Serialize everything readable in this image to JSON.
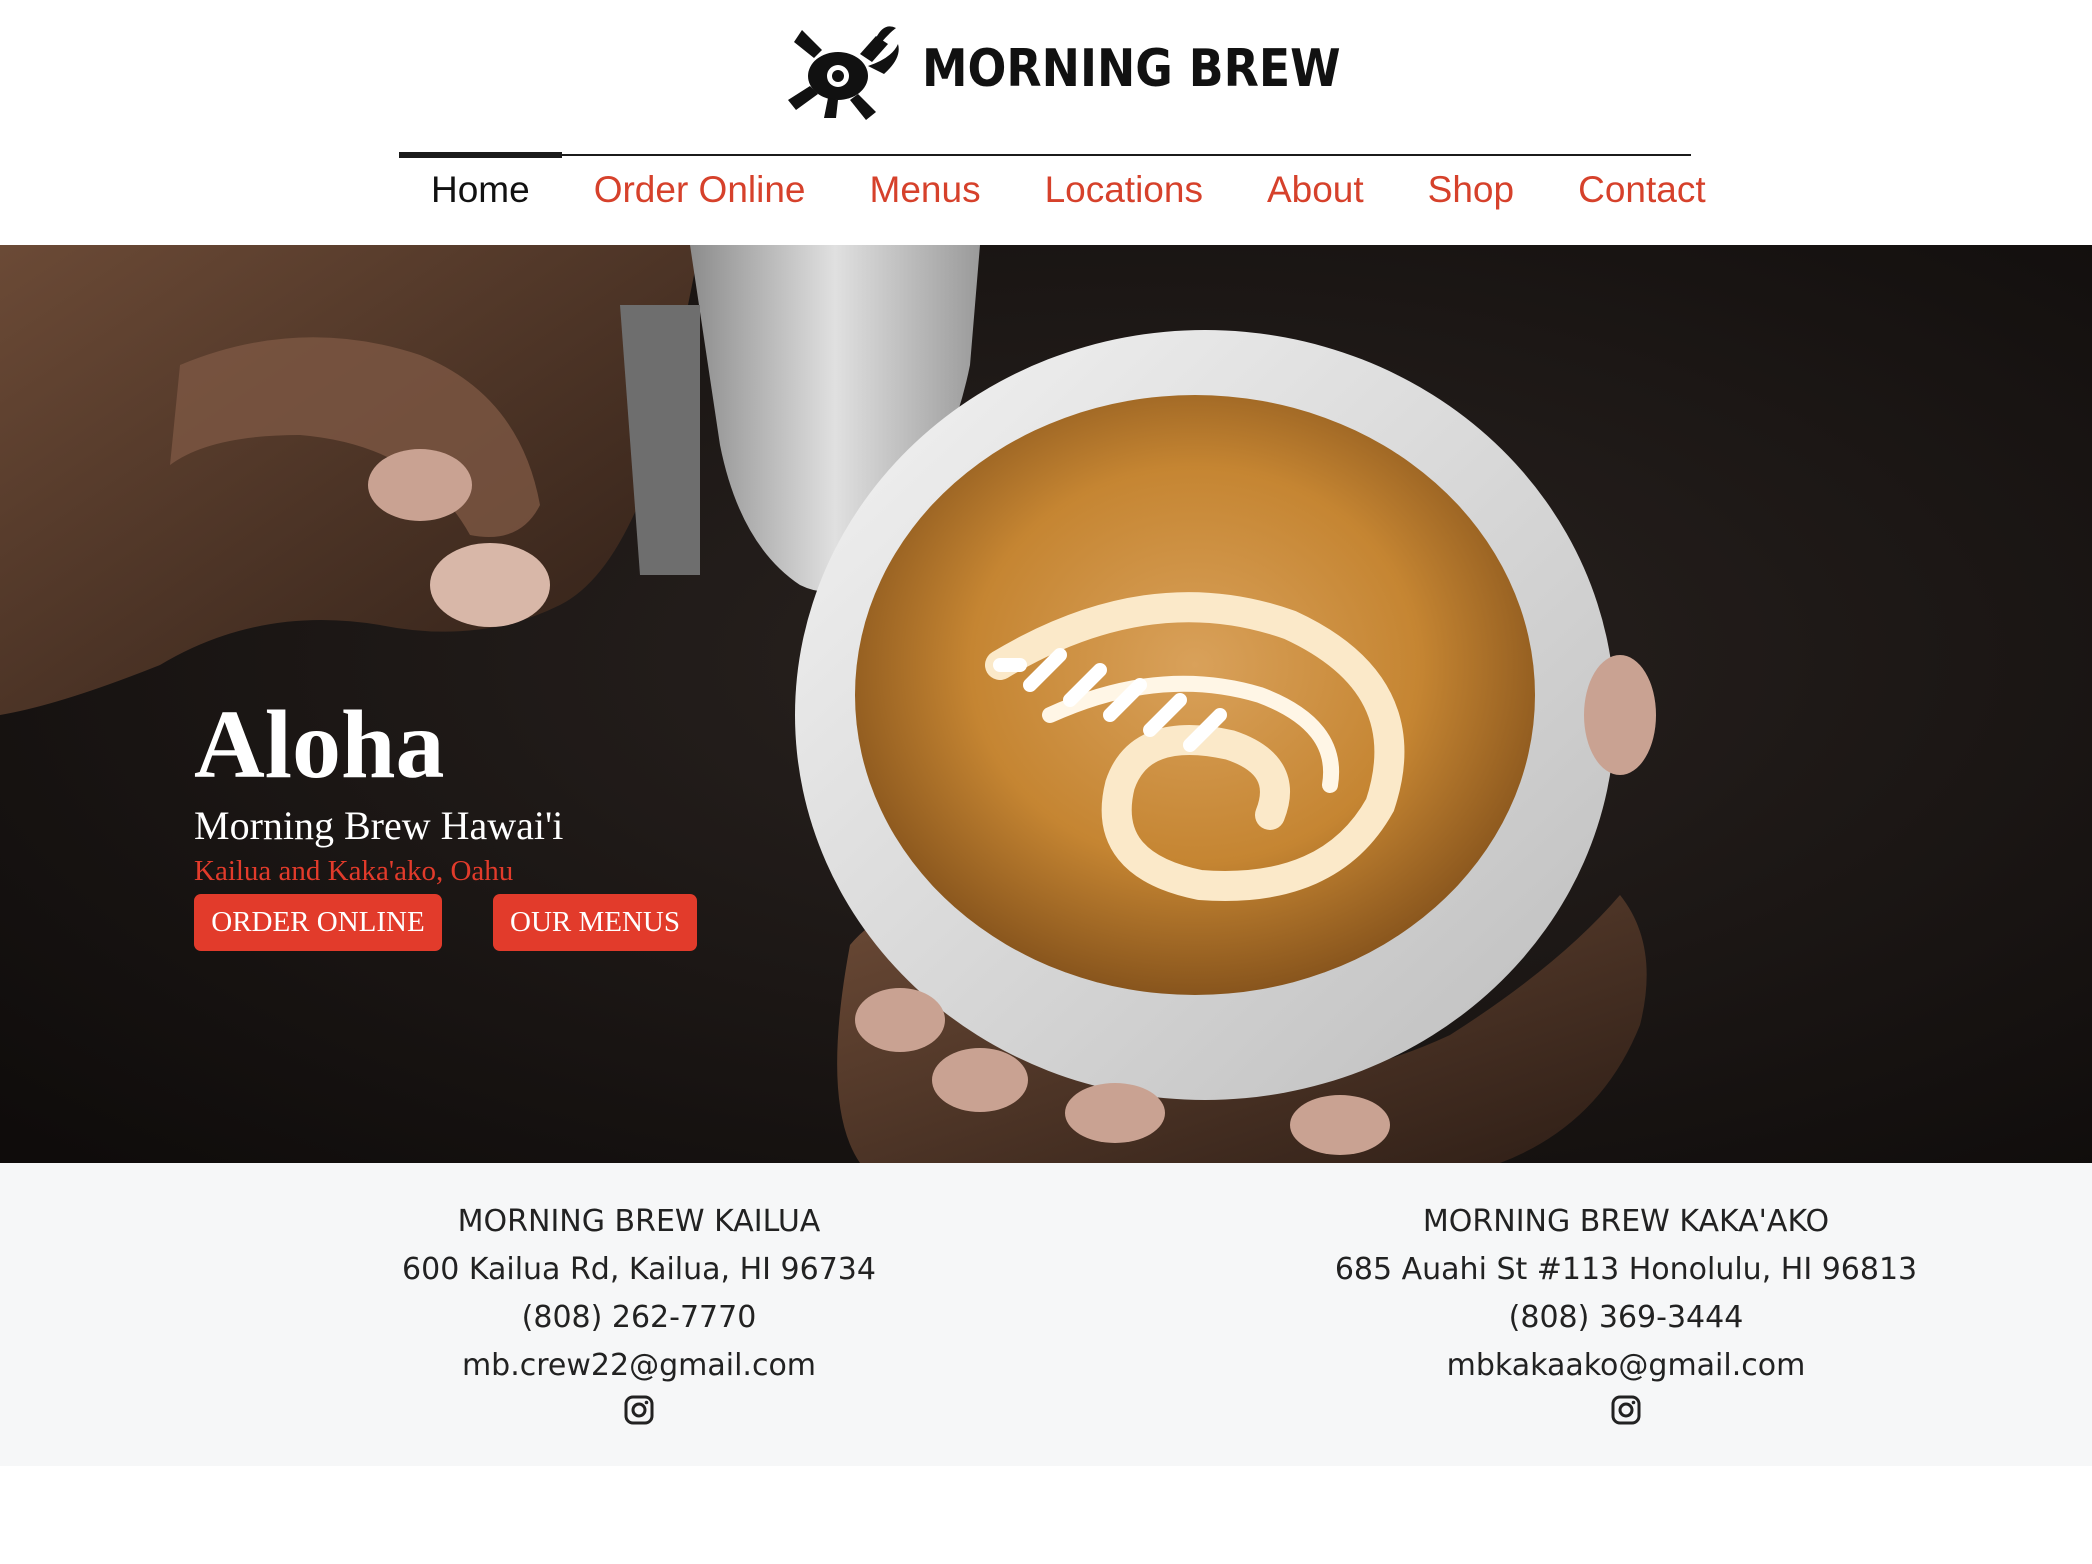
{
  "brand": {
    "name": "MORNING BREW"
  },
  "nav": {
    "items": [
      {
        "label": "Home",
        "active": true
      },
      {
        "label": "Order Online",
        "active": false
      },
      {
        "label": "Menus",
        "active": false
      },
      {
        "label": "Locations",
        "active": false
      },
      {
        "label": "About",
        "active": false
      },
      {
        "label": "Shop",
        "active": false
      },
      {
        "label": "Contact",
        "active": false
      }
    ]
  },
  "hero": {
    "title": "Aloha",
    "subtitle": "Morning Brew Hawai'i",
    "tagline": "Kailua and Kaka'ako, Oahu",
    "buttons": {
      "order": "ORDER ONLINE",
      "menus": "OUR MENUS"
    }
  },
  "locations": [
    {
      "name": "MORNING BREW KAILUA",
      "address": "600 Kailua Rd, Kailua, HI 96734",
      "phone": "(808) 262-7770",
      "email": "mb.crew22@gmail.com",
      "social_icon": "instagram-icon"
    },
    {
      "name": "MORNING BREW KAKA'AKO",
      "address": "685 Auahi St #113 Honolulu, HI 96813",
      "phone": "(808) 369-3444",
      "email": "mbkakaako@gmail.com",
      "social_icon": "instagram-icon"
    }
  ],
  "colors": {
    "accent": "#e23b2b",
    "nav_link": "#d6412b",
    "footer_bg": "#f6f7f8",
    "text_dark": "#111111"
  }
}
